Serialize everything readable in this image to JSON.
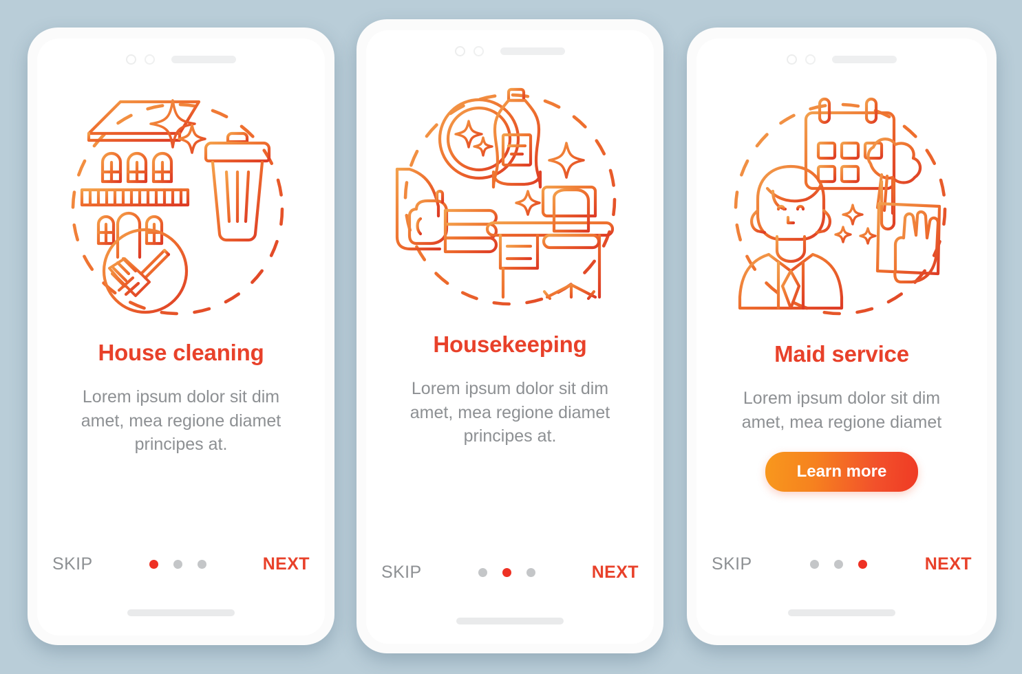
{
  "background_color": "#b9cdd8",
  "accent": {
    "title_red": "#e8412a",
    "body_gray": "#8d9093",
    "dot_active": "#ee3124",
    "dot_inactive": "#c4c6c8",
    "gradient_start": "#f8981d",
    "gradient_end": "#ef3a24"
  },
  "phone_chrome": {
    "camera_icon": "camera-dot-icon",
    "sensor_icon": "sensor-dot-icon",
    "speaker_icon": "speaker-grille-icon",
    "home_indicator": "home-indicator-bar"
  },
  "screens": [
    {
      "id": "house-cleaning",
      "illustration_name": "house-cleaning-illustration",
      "illustration_parts": [
        "house-icon",
        "sparkle-icon",
        "trash-bin-icon",
        "broom-circle-icon",
        "dashed-circle"
      ],
      "title": "House cleaning",
      "body": "Lorem ipsum dolor sit dim amet, mea regione diamet principes at.",
      "has_button": false,
      "button_label": "",
      "skip_label": "SKIP",
      "next_label": "NEXT",
      "dots": 3,
      "active_dot": 0
    },
    {
      "id": "housekeeping",
      "illustration_name": "housekeeping-illustration",
      "illustration_parts": [
        "plate-icon",
        "detergent-bottle-icon",
        "iron-icon",
        "folded-towels-icon",
        "desk-icon",
        "office-chair-icon",
        "sparkle-icon",
        "dashed-circle"
      ],
      "title": "Housekeeping",
      "body": "Lorem ipsum dolor sit dim amet, mea regione diamet principes at.",
      "has_button": false,
      "button_label": "",
      "skip_label": "SKIP",
      "next_label": "NEXT",
      "dots": 3,
      "active_dot": 1
    },
    {
      "id": "maid-service",
      "illustration_name": "maid-service-illustration",
      "illustration_parts": [
        "calendar-icon",
        "feather-duster-icon",
        "maid-avatar-icon",
        "hand-with-cloth-icon",
        "sparkle-icon",
        "dashed-circle"
      ],
      "title": "Maid service",
      "body": "Lorem ipsum dolor sit dim amet, mea regione diamet",
      "has_button": true,
      "button_label": "Learn more",
      "skip_label": "SKIP",
      "next_label": "NEXT",
      "dots": 3,
      "active_dot": 2
    }
  ]
}
